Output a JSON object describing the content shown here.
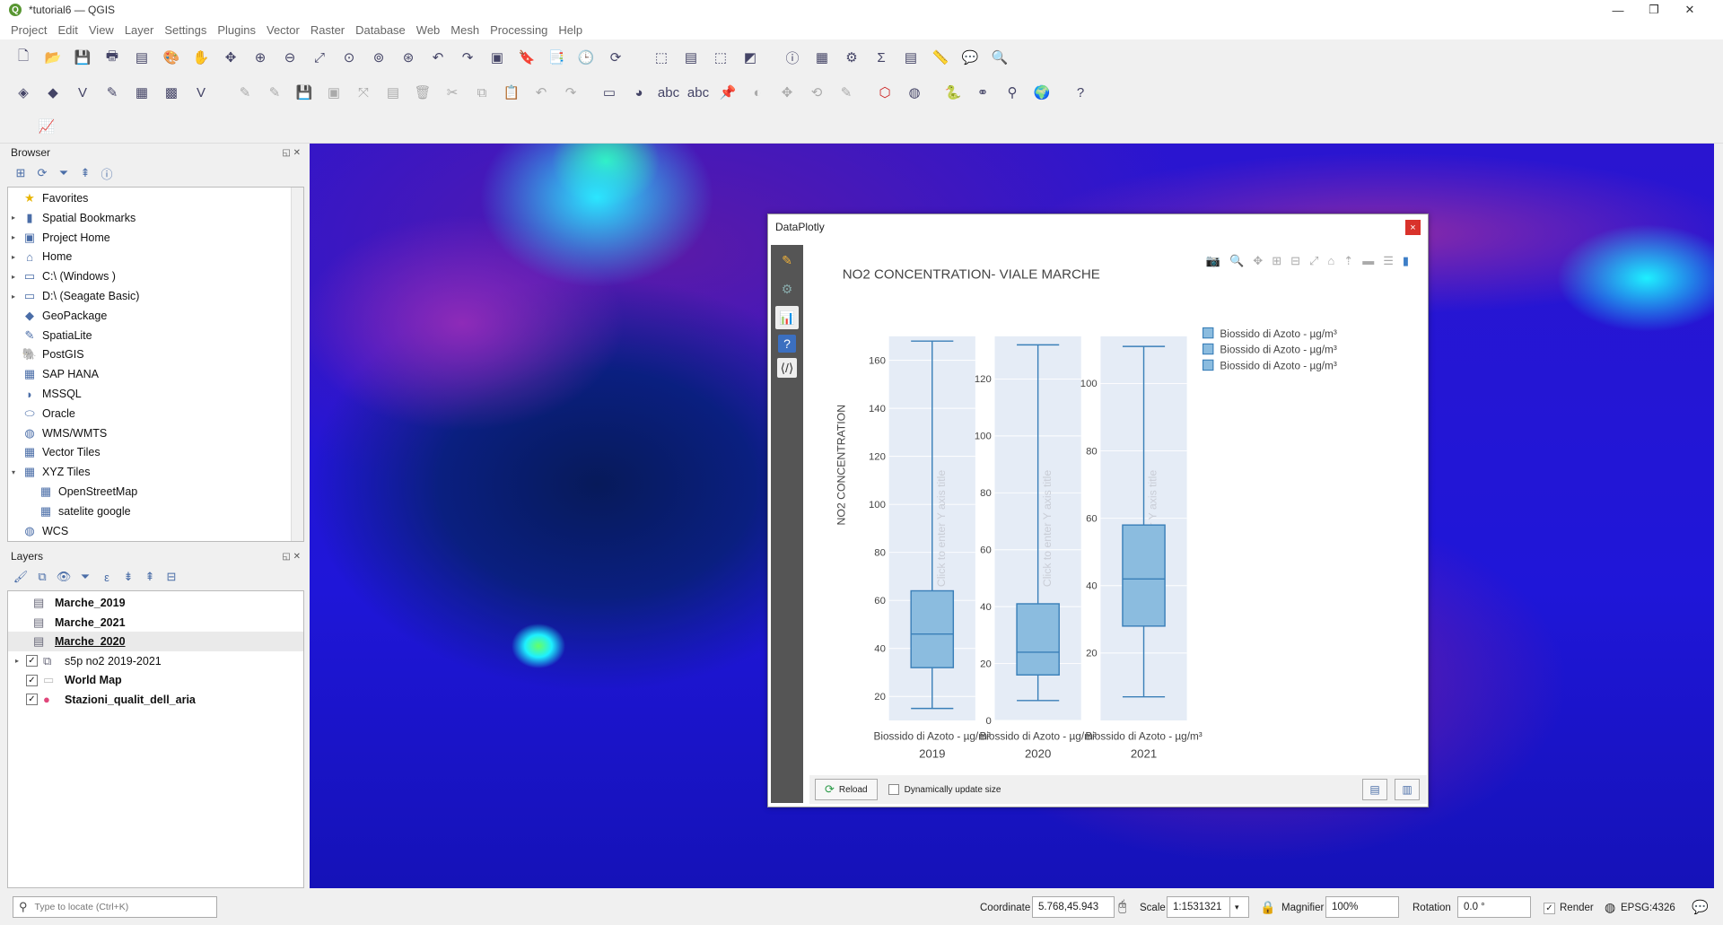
{
  "window": {
    "title": "*tutorial6 — QGIS",
    "app_icon": "Q"
  },
  "menu": [
    "Project",
    "Edit",
    "View",
    "Layer",
    "Settings",
    "Plugins",
    "Vector",
    "Raster",
    "Database",
    "Web",
    "Mesh",
    "Processing",
    "Help"
  ],
  "browser": {
    "title": "Browser",
    "items": [
      {
        "label": "Favorites",
        "icon": "star-icon",
        "glyph": "★",
        "expand": false,
        "indent": 0
      },
      {
        "label": "Spatial Bookmarks",
        "icon": "bookmark-icon",
        "glyph": "▮",
        "expand": true,
        "indent": 0
      },
      {
        "label": "Project Home",
        "icon": "project-home-icon",
        "glyph": "▣",
        "expand": true,
        "indent": 0
      },
      {
        "label": "Home",
        "icon": "home-icon",
        "glyph": "⌂",
        "expand": true,
        "indent": 0
      },
      {
        "label": "C:\\ (Windows )",
        "icon": "drive-icon",
        "glyph": "▭",
        "expand": true,
        "indent": 0
      },
      {
        "label": "D:\\ (Seagate Basic)",
        "icon": "drive-icon",
        "glyph": "▭",
        "expand": true,
        "indent": 0
      },
      {
        "label": "GeoPackage",
        "icon": "geopackage-icon",
        "glyph": "◆",
        "expand": false,
        "indent": 0
      },
      {
        "label": "SpatiaLite",
        "icon": "spatialite-icon",
        "glyph": "✎",
        "expand": false,
        "indent": 0
      },
      {
        "label": "PostGIS",
        "icon": "postgis-icon",
        "glyph": "🐘",
        "expand": false,
        "indent": 0
      },
      {
        "label": "SAP HANA",
        "icon": "sap-hana-icon",
        "glyph": "▦",
        "expand": false,
        "indent": 0
      },
      {
        "label": "MSSQL",
        "icon": "mssql-icon",
        "glyph": "◗",
        "expand": false,
        "indent": 0
      },
      {
        "label": "Oracle",
        "icon": "oracle-icon",
        "glyph": "⬭",
        "expand": false,
        "indent": 0
      },
      {
        "label": "WMS/WMTS",
        "icon": "globe-icon",
        "glyph": "◍",
        "expand": false,
        "indent": 0
      },
      {
        "label": "Vector Tiles",
        "icon": "vector-tiles-icon",
        "glyph": "▦",
        "expand": false,
        "indent": 0
      },
      {
        "label": "XYZ Tiles",
        "icon": "xyz-tiles-icon",
        "glyph": "▦",
        "expand": "open",
        "indent": 0
      },
      {
        "label": "OpenStreetMap",
        "icon": "tiles-icon",
        "glyph": "▦",
        "expand": false,
        "indent": 1
      },
      {
        "label": "satelite google",
        "icon": "tiles-icon",
        "glyph": "▦",
        "expand": false,
        "indent": 1
      },
      {
        "label": "WCS",
        "icon": "wcs-icon",
        "glyph": "◍",
        "expand": false,
        "indent": 0
      }
    ]
  },
  "layers": {
    "title": "Layers",
    "items": [
      {
        "label": "Marche_2019",
        "checked": null,
        "icon": "table-icon",
        "glyph": "▤",
        "bold": true,
        "underline": false,
        "indent": 0,
        "expand": false
      },
      {
        "label": "Marche_2021",
        "checked": null,
        "icon": "table-icon",
        "glyph": "▤",
        "bold": true,
        "underline": false,
        "indent": 0,
        "expand": false
      },
      {
        "label": "Marche_2020",
        "checked": null,
        "icon": "table-icon",
        "glyph": "▤",
        "bold": true,
        "underline": true,
        "indent": 0,
        "expand": false
      },
      {
        "label": "s5p no2 2019-2021",
        "checked": true,
        "icon": "raster-group-icon",
        "glyph": "⧉",
        "bold": false,
        "underline": false,
        "indent": 0,
        "expand": true
      },
      {
        "label": "World Map",
        "checked": true,
        "icon": "polygon-icon",
        "glyph": "▭",
        "bold": true,
        "underline": false,
        "indent": 0,
        "expand": false
      },
      {
        "label": "Stazioni_qualit_dell_aria",
        "checked": true,
        "icon": "point-icon",
        "glyph": "●",
        "bold": true,
        "underline": false,
        "indent": 0,
        "expand": false
      }
    ]
  },
  "dialog": {
    "title": "DataPlotly",
    "close": "×",
    "reload_label": "Reload",
    "dynamic_label": "Dynamically update size"
  },
  "chart_data": {
    "type": "box",
    "title": "NO2 CONCENTRATION- VIALE MARCHE",
    "ylabel": "NO2 CONCENTRATION",
    "placeholder_ylabel": "Click to enter Y axis title",
    "x_label": "Biossido di Azoto - µg/m³",
    "boxes": [
      {
        "category": "2019",
        "min": 15,
        "q1": 32,
        "median": 46,
        "q3": 64,
        "max": 168,
        "ylim": [
          10,
          170
        ],
        "ticks": [
          20,
          40,
          60,
          80,
          100,
          120,
          140,
          160
        ]
      },
      {
        "category": "2020",
        "min": 7,
        "q1": 16,
        "median": 24,
        "q3": 41,
        "max": 132,
        "ylim": [
          0,
          135
        ],
        "ticks": [
          0,
          20,
          40,
          60,
          80,
          100,
          120
        ]
      },
      {
        "category": "2021",
        "min": 7,
        "q1": 28,
        "median": 42,
        "q3": 58,
        "max": 111,
        "ylim": [
          0,
          114
        ],
        "ticks": [
          20,
          40,
          60,
          80,
          100
        ]
      }
    ],
    "legend": [
      "Biossido di Azoto - µg/m³",
      "Biossido di Azoto - µg/m³",
      "Biossido di Azoto - µg/m³"
    ],
    "legend_position": "top-right",
    "box_color": "#8bbcdf",
    "line_color": "#3a7fb8",
    "panel_color": "#e5ecf6"
  },
  "status": {
    "locate_placeholder": "Type to locate (Ctrl+K)",
    "coordinate_label": "Coordinate",
    "coordinate": "5.768,45.943",
    "scale_label": "Scale",
    "scale": "1:1531321",
    "magnifier_label": "Magnifier",
    "magnifier": "100%",
    "rotation_label": "Rotation",
    "rotation": "0.0 °",
    "render_label": "Render",
    "crs": "EPSG:4326"
  }
}
